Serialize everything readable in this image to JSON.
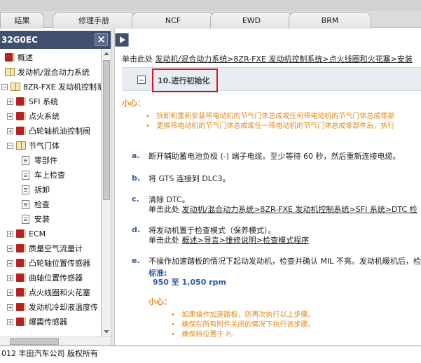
{
  "tabs": [
    {
      "label": "结果"
    },
    {
      "label": "修理手册"
    },
    {
      "label": "NCF"
    },
    {
      "label": "EWD"
    },
    {
      "label": "BRM"
    }
  ],
  "left_panel": {
    "title": "32G0EC",
    "close_glyph": "×"
  },
  "tree": [
    {
      "label": "概述",
      "icon": "closed-book-icon",
      "expander": ""
    },
    {
      "label": "发动机/混合动力系统",
      "icon": "open-book-icon",
      "expander": ""
    },
    {
      "label": "8ZR-FXE 发动机控制系",
      "icon": "open-book-icon",
      "expander": "−"
    },
    {
      "label": "SFI 系统",
      "icon": "closed-book-icon",
      "expander": "+"
    },
    {
      "label": "点火系统",
      "icon": "closed-book-icon",
      "expander": "+"
    },
    {
      "label": "凸轮轴机油控制阀",
      "icon": "closed-book-icon",
      "expander": "+"
    },
    {
      "label": "节气门体",
      "icon": "open-book-icon",
      "expander": "−"
    },
    {
      "label": "零部件",
      "icon": "page-icon",
      "expander": ""
    },
    {
      "label": "车上检查",
      "icon": "page-icon",
      "expander": ""
    },
    {
      "label": "拆卸",
      "icon": "page-icon",
      "expander": ""
    },
    {
      "label": "检查",
      "icon": "page-icon",
      "expander": ""
    },
    {
      "label": "安装",
      "icon": "page-icon",
      "expander": ""
    },
    {
      "label": "ECM",
      "icon": "closed-book-icon",
      "expander": "+"
    },
    {
      "label": "质量空气流量计",
      "icon": "closed-book-icon",
      "expander": "+"
    },
    {
      "label": "凸轮轴位置传感器",
      "icon": "closed-book-icon",
      "expander": "+"
    },
    {
      "label": "曲轴位置传感器",
      "icon": "closed-book-icon",
      "expander": "+"
    },
    {
      "label": "点火线圈和火花塞",
      "icon": "closed-book-icon",
      "expander": "+"
    },
    {
      "label": "发动机冷却液温度传",
      "icon": "closed-book-icon",
      "expander": "+"
    },
    {
      "label": "爆震传感器",
      "icon": "closed-book-icon",
      "expander": "+"
    }
  ],
  "content": {
    "breadcrumb_prefix": "单击此处",
    "breadcrumb_link": "发动机/混合动力系统>8ZR-FXE 发动机控制系统>点火线圈和火花塞>安装",
    "step_title": "10.进行初始化",
    "caution_title": "小心：",
    "caution_items": [
      "拆卸和重新安装带电动机的节气门体总成或任何带电动机的节气门体总成零部",
      "更换带电动机的节气门体总成或任一带电动机的节气门体总成零部件后，执行"
    ],
    "steps": [
      {
        "letter": "a.",
        "text": "断开辅助蓄电池负极 (-) 端子电缆。至少等待 60 秒，然后重新连接电缆。"
      },
      {
        "letter": "b.",
        "text": "将 GTS 连接到 DLC3。"
      },
      {
        "letter": "c.",
        "text": "清除 DTC。",
        "sub_prefix": "单击此处",
        "sub_link": "发动机/混合动力系统>8ZR-FXE 发动机控制系统>SFI 系统>DTC 检"
      },
      {
        "letter": "d.",
        "text": "将发动机置于检查模式（保养模式）。",
        "sub_prefix": "单击此处",
        "sub_link": "概述>导言>维修说明>检查模式程序"
      },
      {
        "letter": "e.",
        "text": "不操作加速踏板的情况下起动发动机，检查并确认 MIL 不亮。发动机暖机后，检"
      }
    ],
    "standard_label": "标准:",
    "standard_value": "950 至 1,050 rpm",
    "caution2_title": "小心：",
    "caution2_items": [
      "如果操作加速踏板，则再次执行以上步骤。",
      "确保在所有附件关闭的情况下执行该步骤。",
      "确保档位置于 P。"
    ]
  },
  "footer": {
    "text": "012 丰田汽车公司   版权所有"
  },
  "colors": {
    "header_bg": "#3f4f6d",
    "caution": "#e08a1e",
    "highlight": "#e0141e",
    "standard": "#2e5aa8"
  }
}
